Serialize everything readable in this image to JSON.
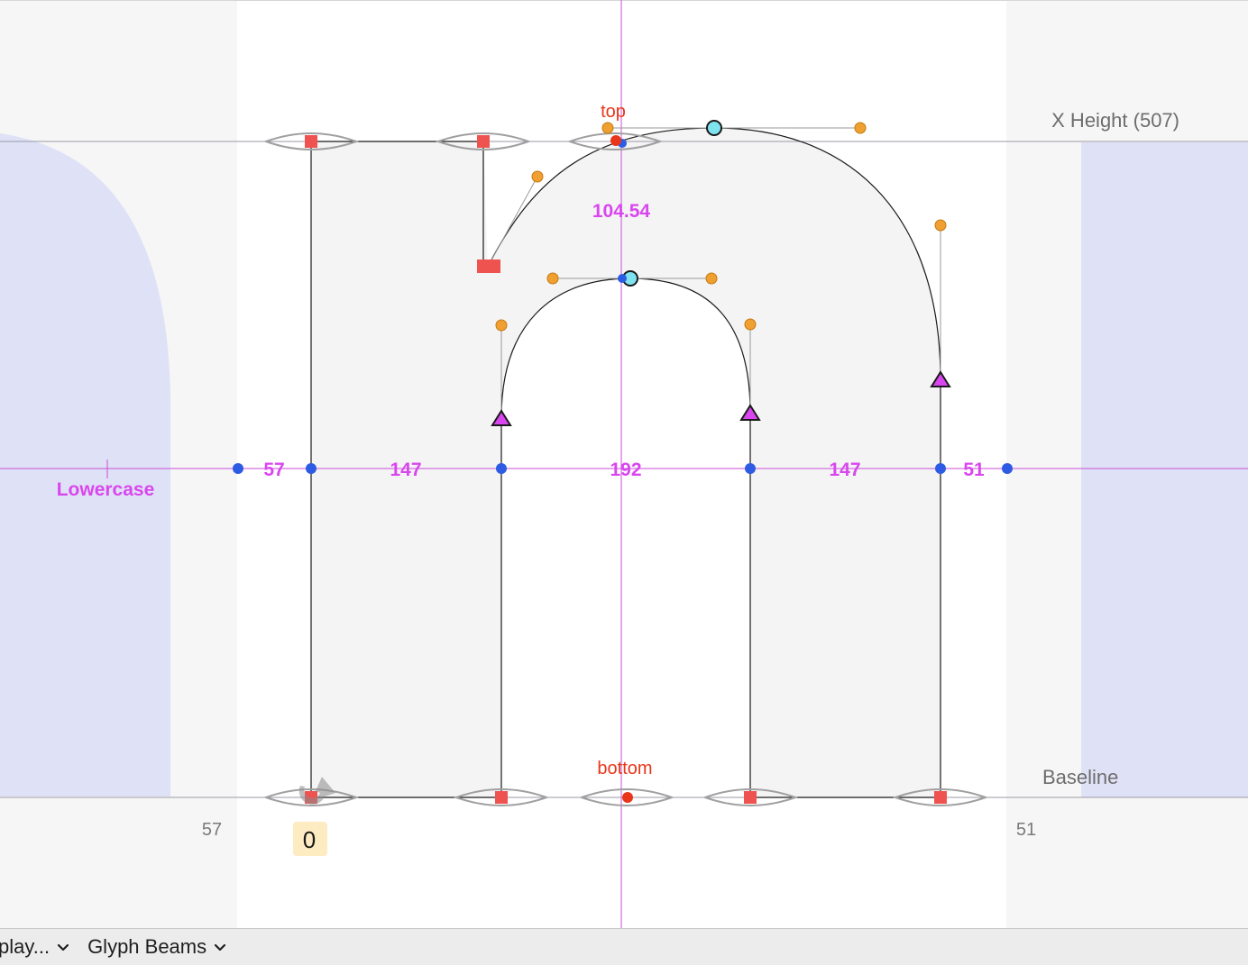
{
  "editor": {
    "guidelines": {
      "x_height_label": "X Height (507)",
      "baseline_label": "Baseline"
    },
    "anchors": {
      "top": "top",
      "bottom": "bottom"
    },
    "measurement": {
      "label": "Lowercase",
      "segments": [
        "57",
        "147",
        "192",
        "147",
        "51"
      ]
    },
    "curve_measure": "104.54",
    "sidebearings": {
      "left": "57",
      "right": "51"
    },
    "selected_value": "0",
    "colors": {
      "accent_magenta": "#d946ef",
      "anchor_red": "#e8361a",
      "node_square": "#ef5350",
      "node_smooth_blue": "#2d5be3",
      "handle_orange": "#f0a030",
      "extremum_cyan": "#7fe3ef",
      "neighbor_glyph": "#dfe2f6"
    }
  },
  "bottom_bar": {
    "display_menu": "play...",
    "beams_menu": "Glyph Beams"
  }
}
